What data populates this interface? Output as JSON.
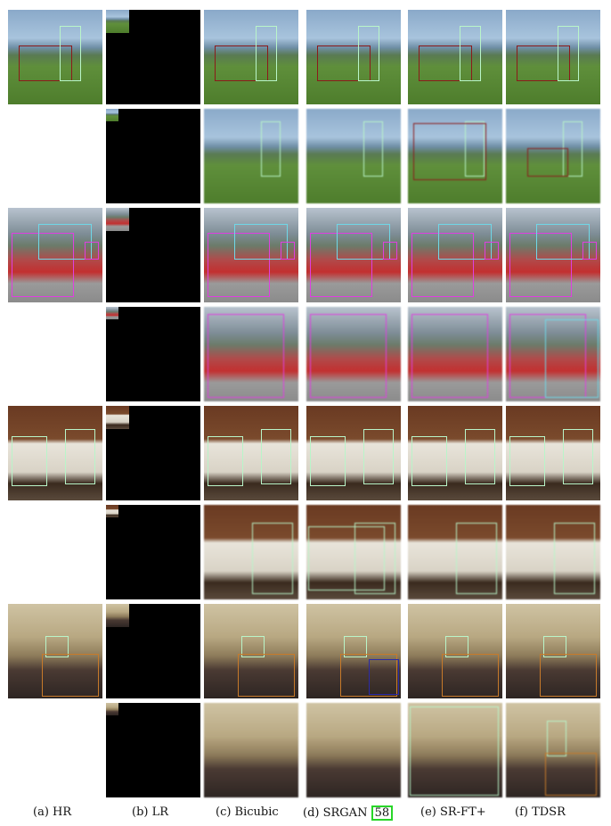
{
  "captions": {
    "hr": "(a) HR",
    "lr": "(b) LR",
    "bicubic": "(c) Bicubic",
    "srgan_prefix": "(d) SRGAN",
    "srgan_ref": "58",
    "srft": "(e) SR-FT+",
    "tdsr": "(f) TDSR"
  },
  "colors": {
    "reference_box": "#29d629",
    "person_box": "#b9f5c9",
    "motorcycle_box": "#8b1a1a",
    "car_box": "#e03ee0",
    "bus_box": "#6fd8e8",
    "dog_box": "#c77a2a",
    "chair_box": "#2a2aa8"
  }
}
